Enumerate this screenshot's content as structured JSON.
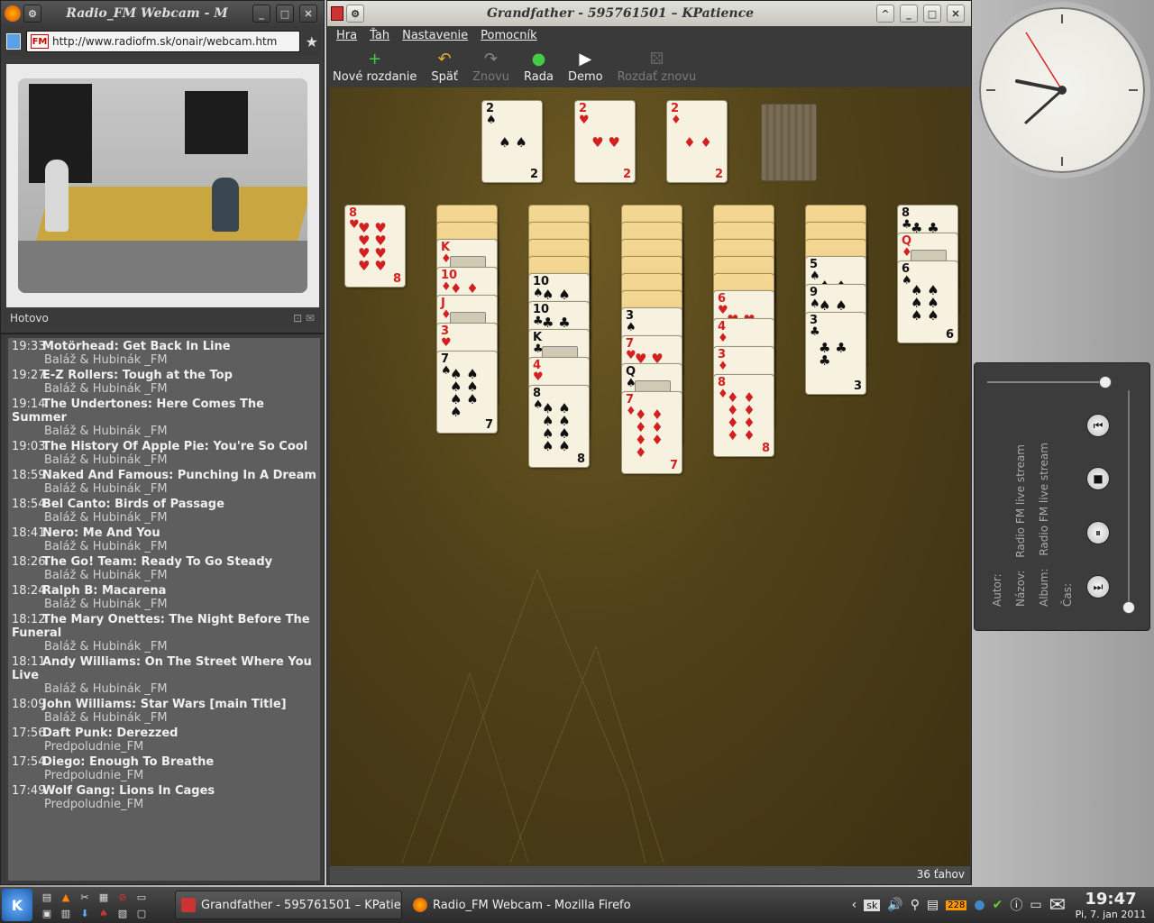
{
  "firefox": {
    "title": "Radio_FM Webcam - M",
    "url": "http://www.radiofm.sk/onair/webcam.htm",
    "status": "Hotovo",
    "fm_badge": "FM"
  },
  "playlist": [
    {
      "time": "19:33",
      "song": "Motörhead: Get Back In Line",
      "show": "Baláž & Hubinák _FM"
    },
    {
      "time": "19:27",
      "song": "E-Z Rollers: Tough at the Top",
      "show": "Baláž & Hubinák _FM"
    },
    {
      "time": "19:14",
      "song": "The Undertones: Here Comes The Summer",
      "show": "Baláž & Hubinák _FM"
    },
    {
      "time": "19:03",
      "song": "The History Of Apple Pie: You're So Cool",
      "show": "Baláž & Hubinák _FM"
    },
    {
      "time": "18:59",
      "song": "Naked And Famous: Punching In A Dream",
      "show": "Baláž & Hubinák _FM"
    },
    {
      "time": "18:54",
      "song": "Bel Canto: Birds of Passage",
      "show": "Baláž & Hubinák _FM"
    },
    {
      "time": "18:41",
      "song": "Nero: Me And You",
      "show": "Baláž & Hubinák _FM"
    },
    {
      "time": "18:26",
      "song": "The Go! Team: Ready To Go Steady",
      "show": "Baláž & Hubinák _FM"
    },
    {
      "time": "18:24",
      "song": "Ralph B: Macarena",
      "show": "Baláž & Hubinák _FM"
    },
    {
      "time": "18:12",
      "song": "The Mary Onettes: The Night Before The Funeral",
      "show": "Baláž & Hubinák _FM"
    },
    {
      "time": "18:11",
      "song": "Andy Williams: On The Street Where You Live",
      "show": "Baláž & Hubinák _FM"
    },
    {
      "time": "18:09",
      "song": "John Williams: Star Wars [main Title]",
      "show": "Baláž & Hubinák _FM"
    },
    {
      "time": "17:56",
      "song": "Daft Punk: Derezzed",
      "show": "Predpoludnie_FM"
    },
    {
      "time": "17:54",
      "song": "Diego: Enough To Breathe",
      "show": "Predpoludnie_FM"
    },
    {
      "time": "17:49",
      "song": "Wolf Gang: Lions In Cages",
      "show": "Predpoludnie_FM"
    }
  ],
  "kpatience": {
    "title": "Grandfather - 595761501 – KPatience",
    "menu": [
      "Hra",
      "Ťah",
      "Nastavenie",
      "Pomocník"
    ],
    "toolbar": [
      {
        "label": "Nové rozdanie",
        "icon": "new-deal-icon",
        "glyph": "+",
        "enabled": true
      },
      {
        "label": "Späť",
        "icon": "undo-icon",
        "glyph": "↶",
        "enabled": true
      },
      {
        "label": "Znovu",
        "icon": "redo-icon",
        "glyph": "↷",
        "enabled": false
      },
      {
        "label": "Rada",
        "icon": "hint-icon",
        "glyph": "●",
        "enabled": true
      },
      {
        "label": "Demo",
        "icon": "demo-icon",
        "glyph": "▶",
        "enabled": true
      },
      {
        "label": "Rozdať znovu",
        "icon": "redeal-icon",
        "glyph": "⚄",
        "enabled": false
      }
    ],
    "moves": "36 ťahov",
    "foundations": [
      {
        "rank": "2",
        "suit": "♠",
        "color": "blk"
      },
      {
        "rank": "2",
        "suit": "♥",
        "color": "red"
      },
      {
        "rank": "2",
        "suit": "♦",
        "color": "red"
      }
    ],
    "tableau": [
      {
        "backs": 0,
        "cards": [
          {
            "rank": "8",
            "suit": "♥",
            "color": "red"
          }
        ]
      },
      {
        "backs": 2,
        "cards": [
          {
            "rank": "K",
            "suit": "♦",
            "color": "red"
          },
          {
            "rank": "10",
            "suit": "♦",
            "color": "red"
          },
          {
            "rank": "J",
            "suit": "♦",
            "color": "red"
          },
          {
            "rank": "3",
            "suit": "♥",
            "color": "red"
          },
          {
            "rank": "7",
            "suit": "♠",
            "color": "blk"
          }
        ]
      },
      {
        "backs": 4,
        "cards": [
          {
            "rank": "10",
            "suit": "♠",
            "color": "blk"
          },
          {
            "rank": "10",
            "suit": "♣",
            "color": "blk"
          },
          {
            "rank": "K",
            "suit": "♣",
            "color": "blk"
          },
          {
            "rank": "4",
            "suit": "♥",
            "color": "red"
          },
          {
            "rank": "8",
            "suit": "♠",
            "color": "blk"
          }
        ]
      },
      {
        "backs": 6,
        "cards": [
          {
            "rank": "3",
            "suit": "♠",
            "color": "blk"
          },
          {
            "rank": "7",
            "suit": "♥",
            "color": "red"
          },
          {
            "rank": "Q",
            "suit": "♠",
            "color": "blk"
          },
          {
            "rank": "7",
            "suit": "♦",
            "color": "red"
          }
        ]
      },
      {
        "backs": 5,
        "cards": [
          {
            "rank": "6",
            "suit": "♥",
            "color": "red"
          },
          {
            "rank": "4",
            "suit": "♦",
            "color": "red"
          },
          {
            "rank": "3",
            "suit": "♦",
            "color": "red"
          },
          {
            "rank": "8",
            "suit": "♦",
            "color": "red"
          }
        ]
      },
      {
        "backs": 3,
        "cards": [
          {
            "rank": "5",
            "suit": "♠",
            "color": "blk"
          },
          {
            "rank": "9",
            "suit": "♠",
            "color": "blk"
          },
          {
            "rank": "3",
            "suit": "♣",
            "color": "blk"
          }
        ]
      },
      {
        "backs": 0,
        "cards": [
          {
            "rank": "8",
            "suit": "♣",
            "color": "blk"
          },
          {
            "rank": "Q",
            "suit": "♦",
            "color": "red"
          },
          {
            "rank": "6",
            "suit": "♠",
            "color": "blk"
          }
        ]
      }
    ]
  },
  "player": {
    "labels": [
      "Autor:",
      "Názov:",
      "Album:",
      "Čas:"
    ],
    "values": [
      "",
      "Radio FM live stream",
      "Radio FM live stream",
      ""
    ],
    "buttons": [
      "previous-icon",
      "stop-icon",
      "pause-icon",
      "next-icon"
    ]
  },
  "taskbar": {
    "tasks": [
      {
        "label": "Grandfather - 595761501 – KPatience",
        "active": true
      },
      {
        "label": "Radio_FM Webcam - Mozilla Firefox",
        "active": false
      }
    ],
    "keyboard": "sk",
    "badge": "228",
    "time": "19:47",
    "date": "Pi, 7. jan 2011"
  },
  "colors": {
    "felt": "#5a4a1c",
    "red": "#d21f1f",
    "panel": "#3a3a3a"
  }
}
